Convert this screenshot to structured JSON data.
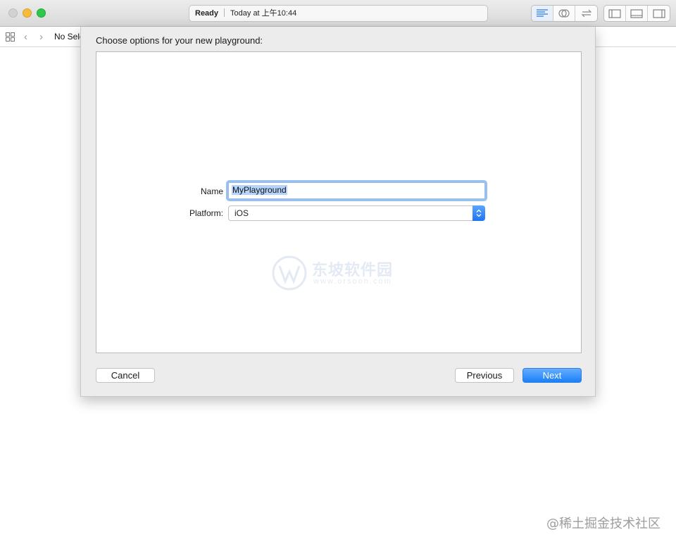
{
  "titlebar": {
    "status_state": "Ready",
    "status_time": "Today at 上午10:44"
  },
  "navbar": {
    "selection_text": "No Sele"
  },
  "sheet": {
    "title": "Choose options for your new playground:",
    "name_label": "Name",
    "name_value": "MyPlayground",
    "platform_label": "Platform:",
    "platform_value": "iOS",
    "cancel_label": "Cancel",
    "previous_label": "Previous",
    "next_label": "Next"
  },
  "watermark": {
    "text": "东坡软件园",
    "url": "www.orsoon.com"
  },
  "corner_watermark": "@稀土掘金技术社区",
  "colors": {
    "accent": "#1b80f8",
    "focus_ring": "#98c1f2",
    "selection": "#b4d4fb"
  }
}
